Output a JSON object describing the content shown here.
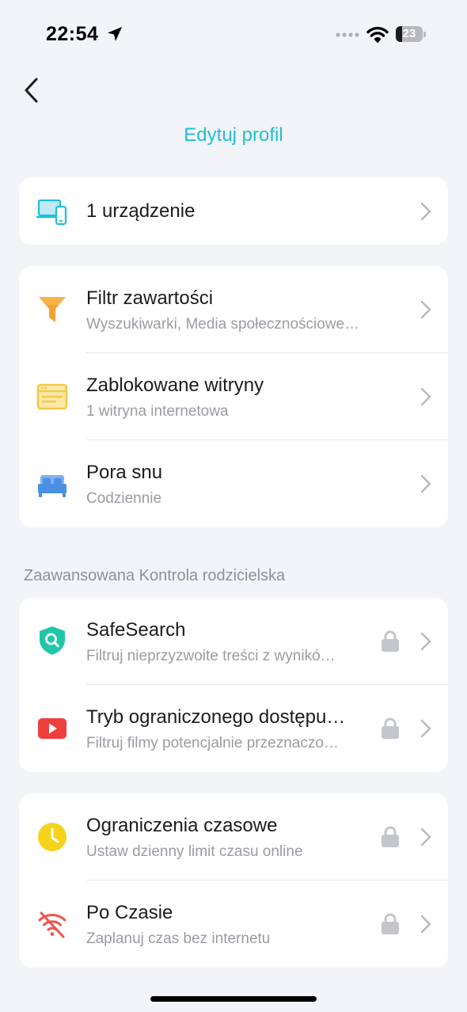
{
  "status_bar": {
    "time": "22:54",
    "battery_level": "23"
  },
  "header": {
    "title": "Edytuj profil",
    "back_icon": "chevron-left-icon"
  },
  "devices": {
    "label": "1 urządzenie",
    "icon": "devices-icon"
  },
  "controls": [
    {
      "title": "Filtr zawartości",
      "subtitle": "Wyszukiwarki, Media społecznościowe…",
      "icon": "filter-icon",
      "color": "#f5a030"
    },
    {
      "title": "Zablokowane witryny",
      "subtitle": "1 witryna internetowa",
      "icon": "browser-window-icon",
      "color": "#f2c94c"
    },
    {
      "title": "Pora snu",
      "subtitle": "Codziennie",
      "icon": "bed-icon",
      "color": "#4a90e2"
    }
  ],
  "advanced": {
    "section_label": "Zaawansowana Kontrola rodzicielska",
    "items": [
      {
        "title": "SafeSearch",
        "subtitle": "Filtruj nieprzyzwoite treści z wynikó…",
        "icon": "shield-search-icon",
        "locked": true,
        "color": "#1fc7a8"
      },
      {
        "title": "Tryb ograniczonego dostępu…",
        "subtitle": "Filtruj filmy potencjalnie przeznaczo…",
        "icon": "youtube-icon",
        "locked": true,
        "color": "#ee3f3f"
      }
    ]
  },
  "time_controls": [
    {
      "title": "Ograniczenia czasowe",
      "subtitle": "Ustaw dzienny limit czasu online",
      "icon": "clock-icon",
      "locked": true,
      "color": "#f6d21b"
    },
    {
      "title": "Po Czasie",
      "subtitle": "Zaplanuj czas bez internetu",
      "icon": "wifi-off-icon",
      "locked": true,
      "color": "#ec5550"
    }
  ],
  "colors": {
    "accent": "#1fbfd6",
    "background": "#f3f4f8",
    "card": "#ffffff",
    "secondary_text": "#9a9ca3"
  }
}
